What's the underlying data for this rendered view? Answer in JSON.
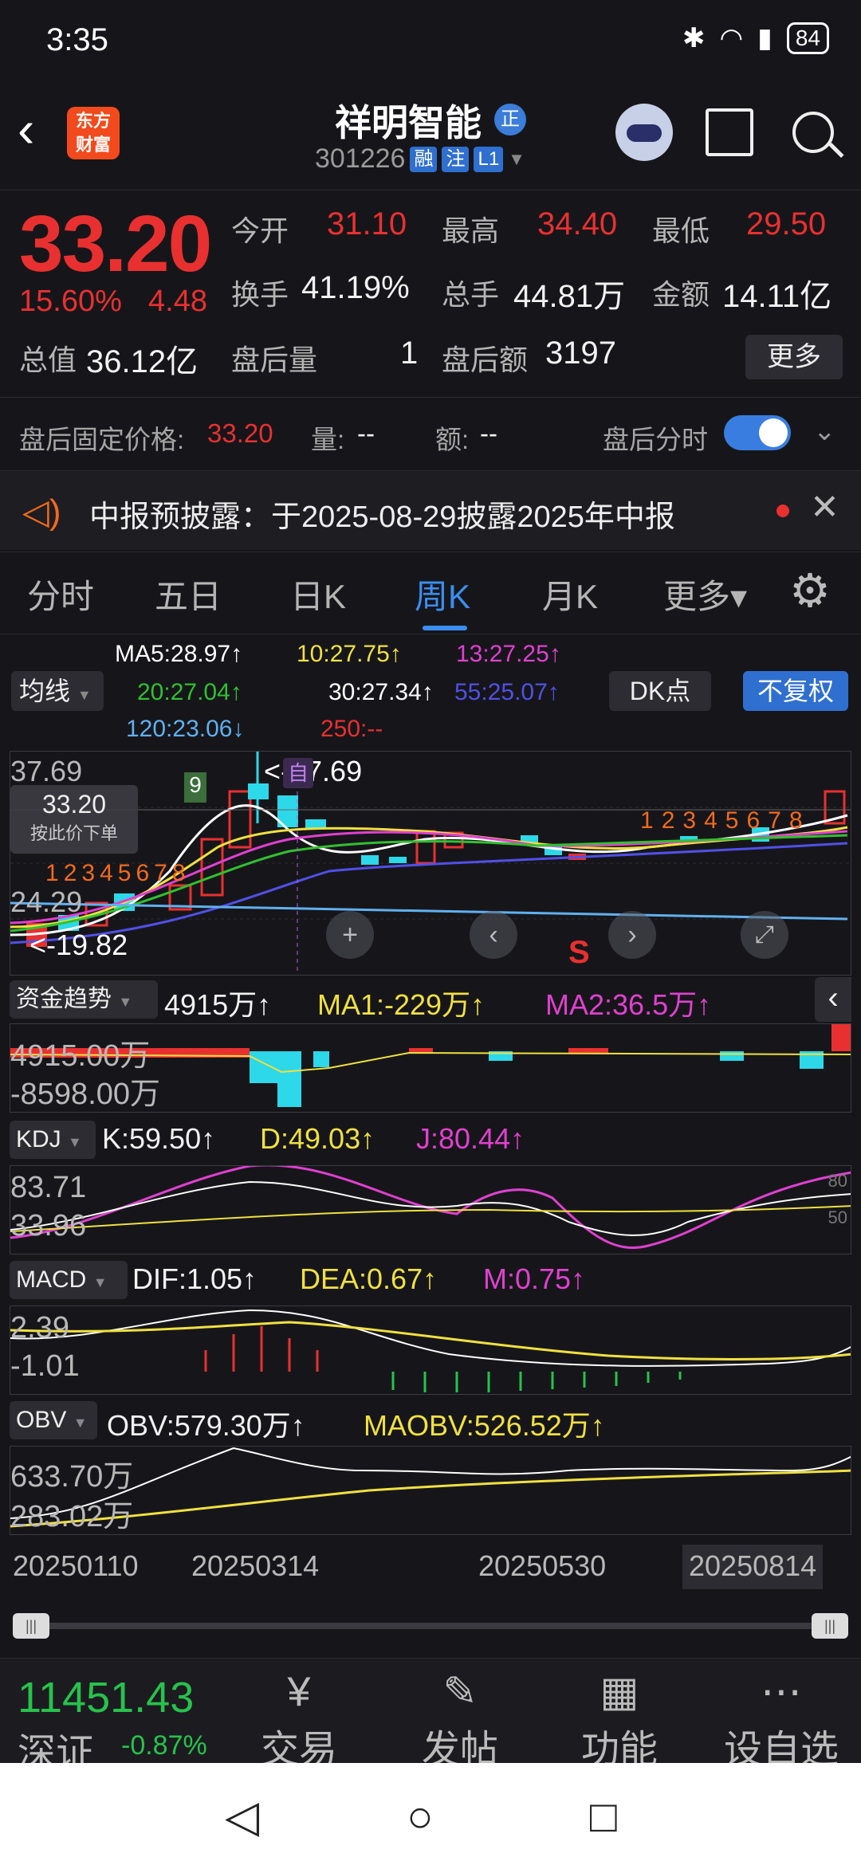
{
  "status_bar": {
    "time": "3:35",
    "battery": "84"
  },
  "header": {
    "logo_line1": "东方",
    "logo_line2": "财富",
    "stock_name": "祥明智能",
    "name_badge": "正",
    "stock_code": "301226",
    "tags": [
      "融",
      "注",
      "L1"
    ]
  },
  "quote": {
    "price": "33.20",
    "change_pct": "15.60%",
    "change": "4.48",
    "open_label": "今开",
    "open": "31.10",
    "high_label": "最高",
    "high": "34.40",
    "low_label": "最低",
    "low": "29.50",
    "turnover_label": "换手",
    "turnover": "41.19%",
    "volume_label": "总手",
    "volume": "44.81万",
    "amount_label": "金额",
    "amount": "14.11亿",
    "mktcap_label": "总值",
    "mktcap": "36.12亿",
    "after_vol_label": "盘后量",
    "after_vol": "1",
    "after_amt_label": "盘后额",
    "after_amt": "3197",
    "more_label": "更多"
  },
  "after_hours": {
    "fixed_price_label": "盘后固定价格:",
    "fixed_price": "33.20",
    "vol_label": "量:",
    "vol": "--",
    "amt_label": "额:",
    "amt": "--",
    "timeshare_label": "盘后分时"
  },
  "notice": {
    "text": "中报预披露：于2025-08-29披露2025年中报"
  },
  "tabs": [
    "分时",
    "五日",
    "日K",
    "周K",
    "月K",
    "更多▾"
  ],
  "active_tab": "周K",
  "ma_legend": {
    "button": "均线",
    "dk_button": "DK点",
    "fq_button": "不复权",
    "ma5": "MA5:28.97↑",
    "ma10": "10:27.75↑",
    "ma13": "13:27.25↑",
    "ma20": "20:27.04↑",
    "ma30": "30:27.34↑",
    "ma55": "55:25.07↑",
    "ma120": "120:23.06↓",
    "ma250": "250:--",
    "colors": {
      "ma5": "#ffffff",
      "ma10": "#f0e040",
      "ma13": "#e040d0",
      "ma20": "#30c030",
      "ma30": "#ffffff",
      "ma55": "#5050e8",
      "ma120": "#60b0f0",
      "ma250": "#e83030"
    }
  },
  "kline": {
    "top_price": "37.69",
    "high_marker": "37.69",
    "cross_price": "33.20",
    "cross_hint": "按此价下单",
    "mid_price": "24.29",
    "low_price": "19.82",
    "low_marker": "19.82",
    "self_marker": "自",
    "sell_marker": "S",
    "nine_marker": "9",
    "td_left": [
      "1",
      "2",
      "3",
      "4",
      "5",
      "6",
      "7",
      "8"
    ],
    "td_right": [
      "1",
      "2",
      "3",
      "4",
      "5",
      "6",
      "7",
      "8"
    ]
  },
  "fund_panel": {
    "button": "资金趋势",
    "value": "4915万↑",
    "ma1": "MA1:-229万↑",
    "ma2": "MA2:36.5万↑",
    "top": "4915.00万",
    "bottom": "-8598.00万"
  },
  "kdj_panel": {
    "button": "KDJ",
    "k": "K:59.50↑",
    "d": "D:49.03↑",
    "j": "J:80.44↑",
    "top": "83.71",
    "bottom": "33.96",
    "ref80": "80",
    "ref50": "50"
  },
  "macd_panel": {
    "button": "MACD",
    "dif": "DIF:1.05↑",
    "dea": "DEA:0.67↑",
    "m": "M:0.75↑",
    "top": "2.39",
    "bottom": "-1.01"
  },
  "obv_panel": {
    "button": "OBV",
    "obv": "OBV:579.30万↑",
    "maobv": "MAOBV:526.52万↑",
    "top": "633.70万",
    "bottom": "283.02万"
  },
  "x_axis": [
    "20250110",
    "20250314",
    "20250530",
    "20250814"
  ],
  "bottom_bar": {
    "index_value": "11451.43",
    "index_name": "深证",
    "index_pct": "-0.87%",
    "nav": [
      {
        "label": "交易",
        "icon": "¥"
      },
      {
        "label": "发帖",
        "icon": "✎"
      },
      {
        "label": "功能",
        "icon": "▦"
      },
      {
        "label": "设自选",
        "icon": "⋯"
      }
    ]
  }
}
